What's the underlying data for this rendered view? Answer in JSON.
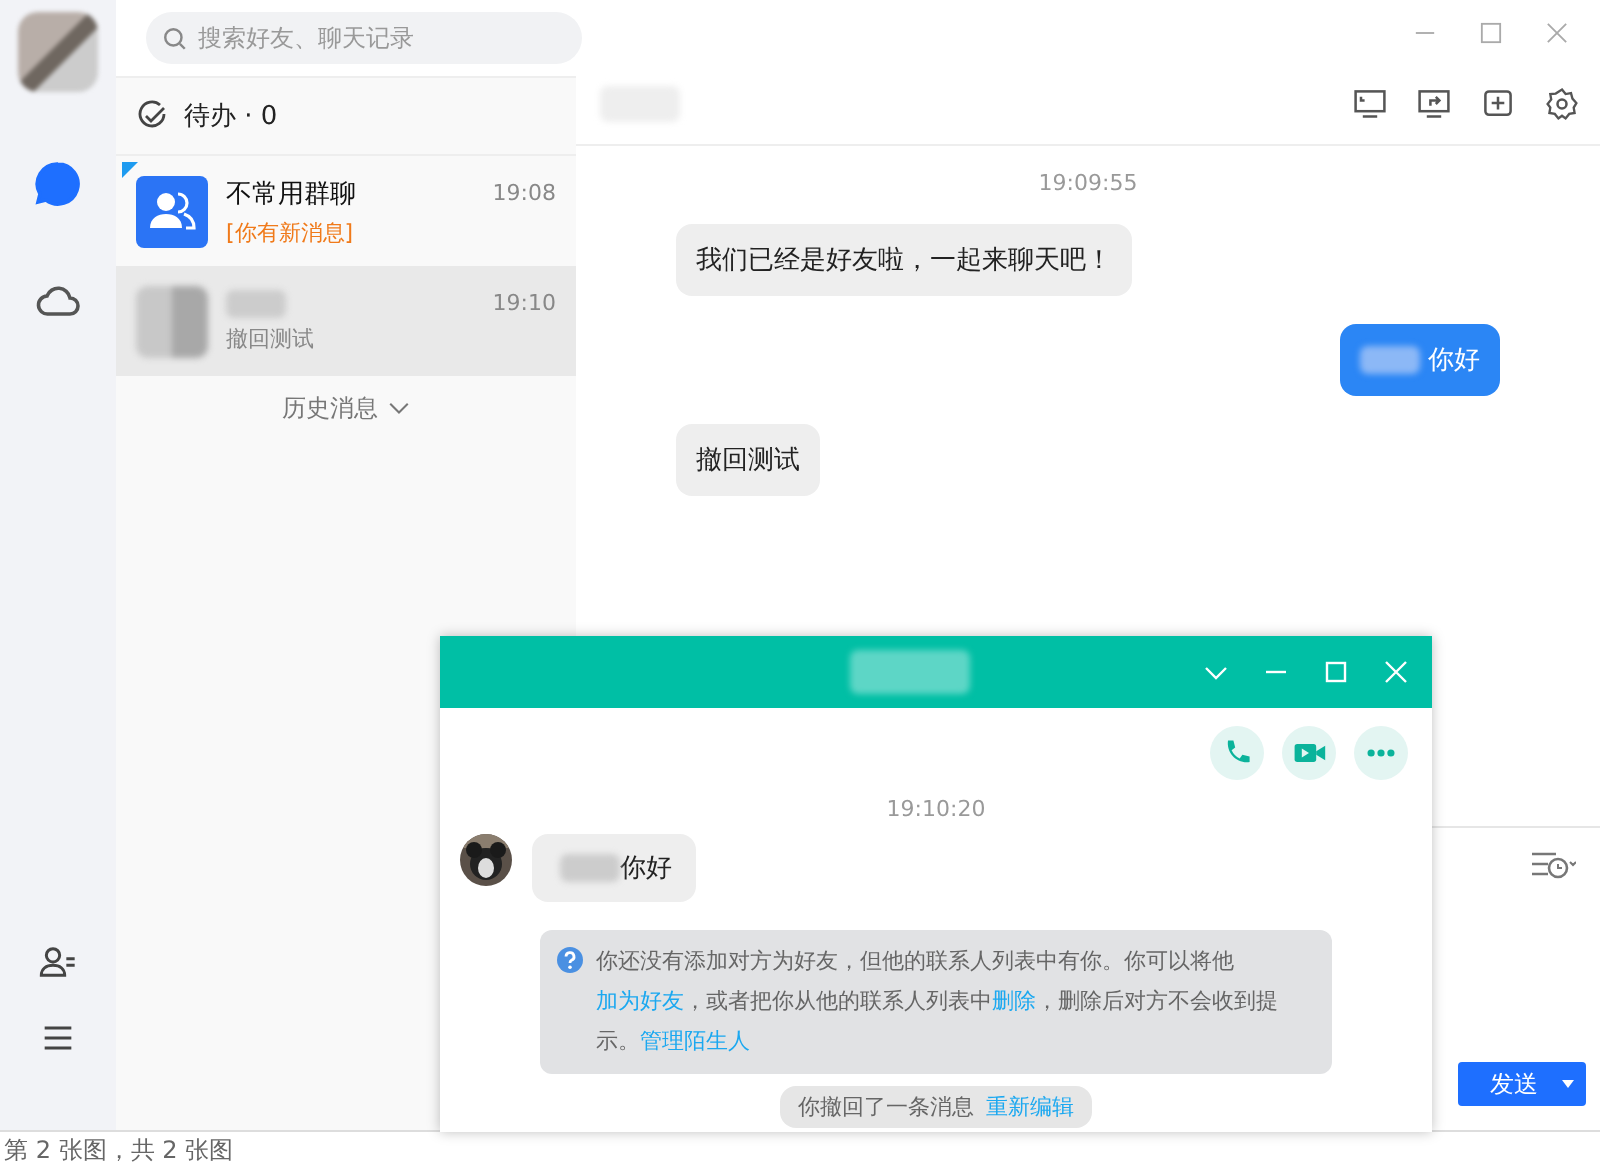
{
  "search": {
    "placeholder": "搜索好友、聊天记录"
  },
  "rail": {
    "items": [
      {
        "kind": "chat",
        "selected": true
      },
      {
        "kind": "cloud",
        "selected": false
      }
    ],
    "bottom": [
      {
        "kind": "contacts"
      },
      {
        "kind": "menu"
      }
    ]
  },
  "todo": {
    "label": "待办 · 0"
  },
  "conversations": [
    {
      "kind": "group",
      "name": "不常用群聊",
      "preview": "[你有新消息]",
      "time": "19:08",
      "pinned": true,
      "alert": true,
      "selected": false
    },
    {
      "kind": "contact",
      "preview": "撤回测试",
      "time": "19:10",
      "pinned": false,
      "alert": false,
      "selected": true
    }
  ],
  "history_link": "历史消息",
  "chat": {
    "messages": [
      {
        "kind": "time",
        "text": "19:09:55"
      },
      {
        "kind": "incoming",
        "text": "我们已经是好友啦，一起来聊天吧！"
      },
      {
        "kind": "outgoing",
        "text": "你好"
      },
      {
        "kind": "incoming",
        "text": "撤回测试"
      }
    ],
    "send_button": "发送"
  },
  "popup": {
    "messages": [
      {
        "kind": "time",
        "text": "19:10:20"
      },
      {
        "kind": "incoming",
        "text": "你好"
      },
      {
        "kind": "notice",
        "parts": [
          {
            "text": "你还没有添加对方为好友，但他的联系人列表中有你。你可以将他",
            "link": false
          },
          {
            "text": "加为好友",
            "link": true
          },
          {
            "text": "，或者把你从他的联系人列表中",
            "link": false
          },
          {
            "text": "删除",
            "link": true
          },
          {
            "text": "，删除后对方不会收到提示。",
            "link": false
          },
          {
            "text": "管理陌生人",
            "link": true
          }
        ]
      },
      {
        "kind": "recall",
        "text": "你撤回了一条消息",
        "link": "重新编辑"
      }
    ]
  },
  "caption": "第 2 张图，共 2 张图"
}
